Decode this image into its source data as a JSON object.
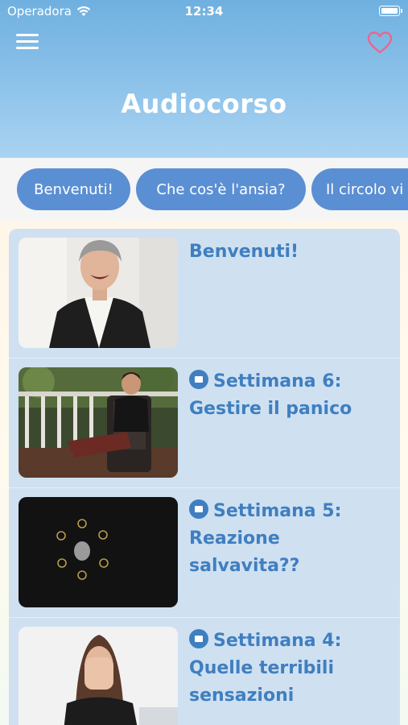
{
  "status_bar": {
    "carrier": "Operadora",
    "time": "12:34"
  },
  "header": {
    "title": "Audiocorso"
  },
  "tabs": [
    {
      "label": "Benvenuti!"
    },
    {
      "label": "Che cos'è l'ansia?"
    },
    {
      "label": "Il circolo vi"
    }
  ],
  "lessons": [
    {
      "title": "Benvenuti!",
      "locked": false
    },
    {
      "title": "Settimana 6: Gestire il panico",
      "locked": true
    },
    {
      "title": "Settimana 5: Reazione salvavita??",
      "locked": true
    },
    {
      "title": "Settimana 4: Quelle terribili sensazioni",
      "locked": true
    }
  ],
  "colors": {
    "header_top": "#6fb0e0",
    "header_bottom": "#a9d3f1",
    "tab_bg": "#5b8fd3",
    "card_bg": "#cfe0f1",
    "accent_text": "#3f7fc0",
    "heart": "#e8688a"
  },
  "icons": [
    "wifi-icon",
    "battery-icon",
    "menu-icon",
    "heart-icon",
    "lock-icon"
  ]
}
